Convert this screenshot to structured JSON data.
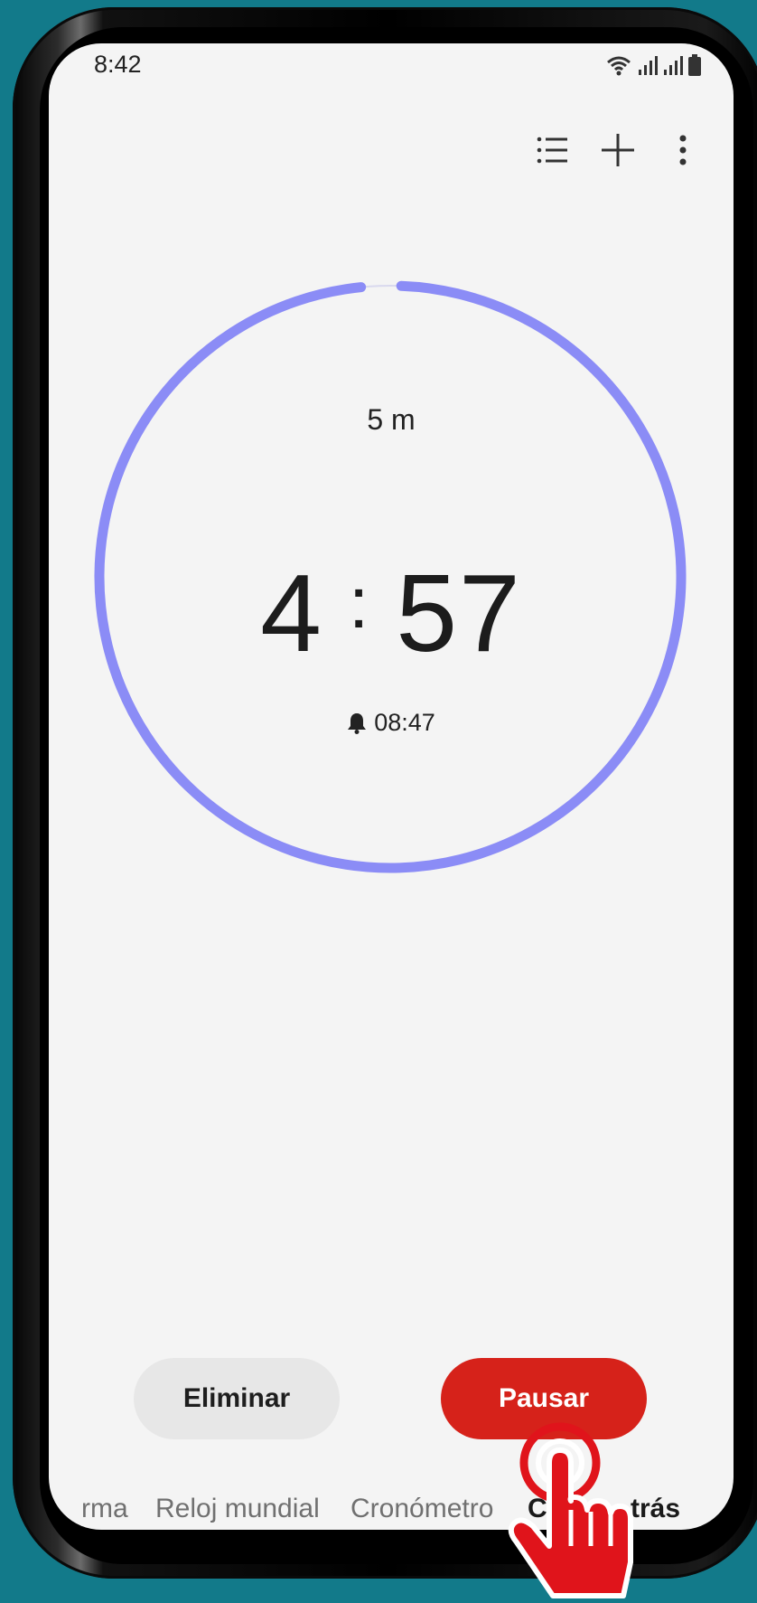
{
  "status_bar": {
    "time": "8:42"
  },
  "timer": {
    "preset": "5 m",
    "minutes": "4",
    "colon": ":",
    "seconds": "57",
    "alarm_time": "08:47",
    "progress_fraction": 0.99
  },
  "buttons": {
    "delete_label": "Eliminar",
    "pause_label": "Pausar"
  },
  "tabs": [
    "rma",
    "Reloj mundial",
    "Cronómetro",
    "C",
    "trás"
  ],
  "colors": {
    "ring": "#8b8cf6",
    "pause_button": "#d6221a",
    "background": "#127a8a"
  },
  "icons": [
    "list-icon",
    "plus-icon",
    "more-vert-icon",
    "bell-icon",
    "wifi-icon",
    "signal-icon",
    "battery-icon",
    "tap-hand-icon"
  ]
}
